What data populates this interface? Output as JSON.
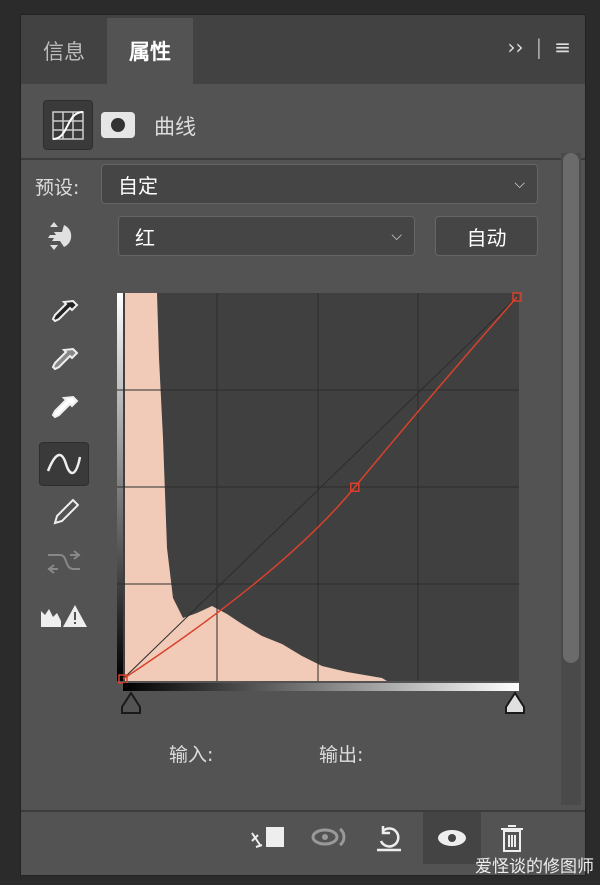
{
  "tabs": [
    {
      "label": "信息",
      "active": false
    },
    {
      "label": "属性",
      "active": true
    }
  ],
  "header": {
    "expand_icon": "double-chevron-right",
    "menu_icon": "hamburger-menu"
  },
  "adjustment": {
    "title": "曲线",
    "icons": [
      "curves-icon",
      "mask-icon"
    ]
  },
  "preset": {
    "label": "预设:",
    "value": "自定"
  },
  "channel": {
    "value": "红",
    "auto_label": "自动"
  },
  "tools": [
    "on-image-adjust",
    "eyedropper-black",
    "eyedropper-gray",
    "eyedropper-white",
    "curve-point-edit",
    "pencil",
    "smooth-curve",
    "clipping-warning"
  ],
  "curve": {
    "channel_color": "#d9412b",
    "points": [
      [
        0,
        0
      ],
      [
        150,
        128
      ],
      [
        255,
        255
      ]
    ],
    "histogram_color": "#f2cbb8"
  },
  "readout": {
    "input_label": "输入:",
    "output_label": "输出:"
  },
  "footer": {
    "icons": [
      "clip-to-layer",
      "view-previous-state",
      "reset",
      "toggle-visibility",
      "delete"
    ]
  },
  "watermark": "爱怪谈的修图师"
}
